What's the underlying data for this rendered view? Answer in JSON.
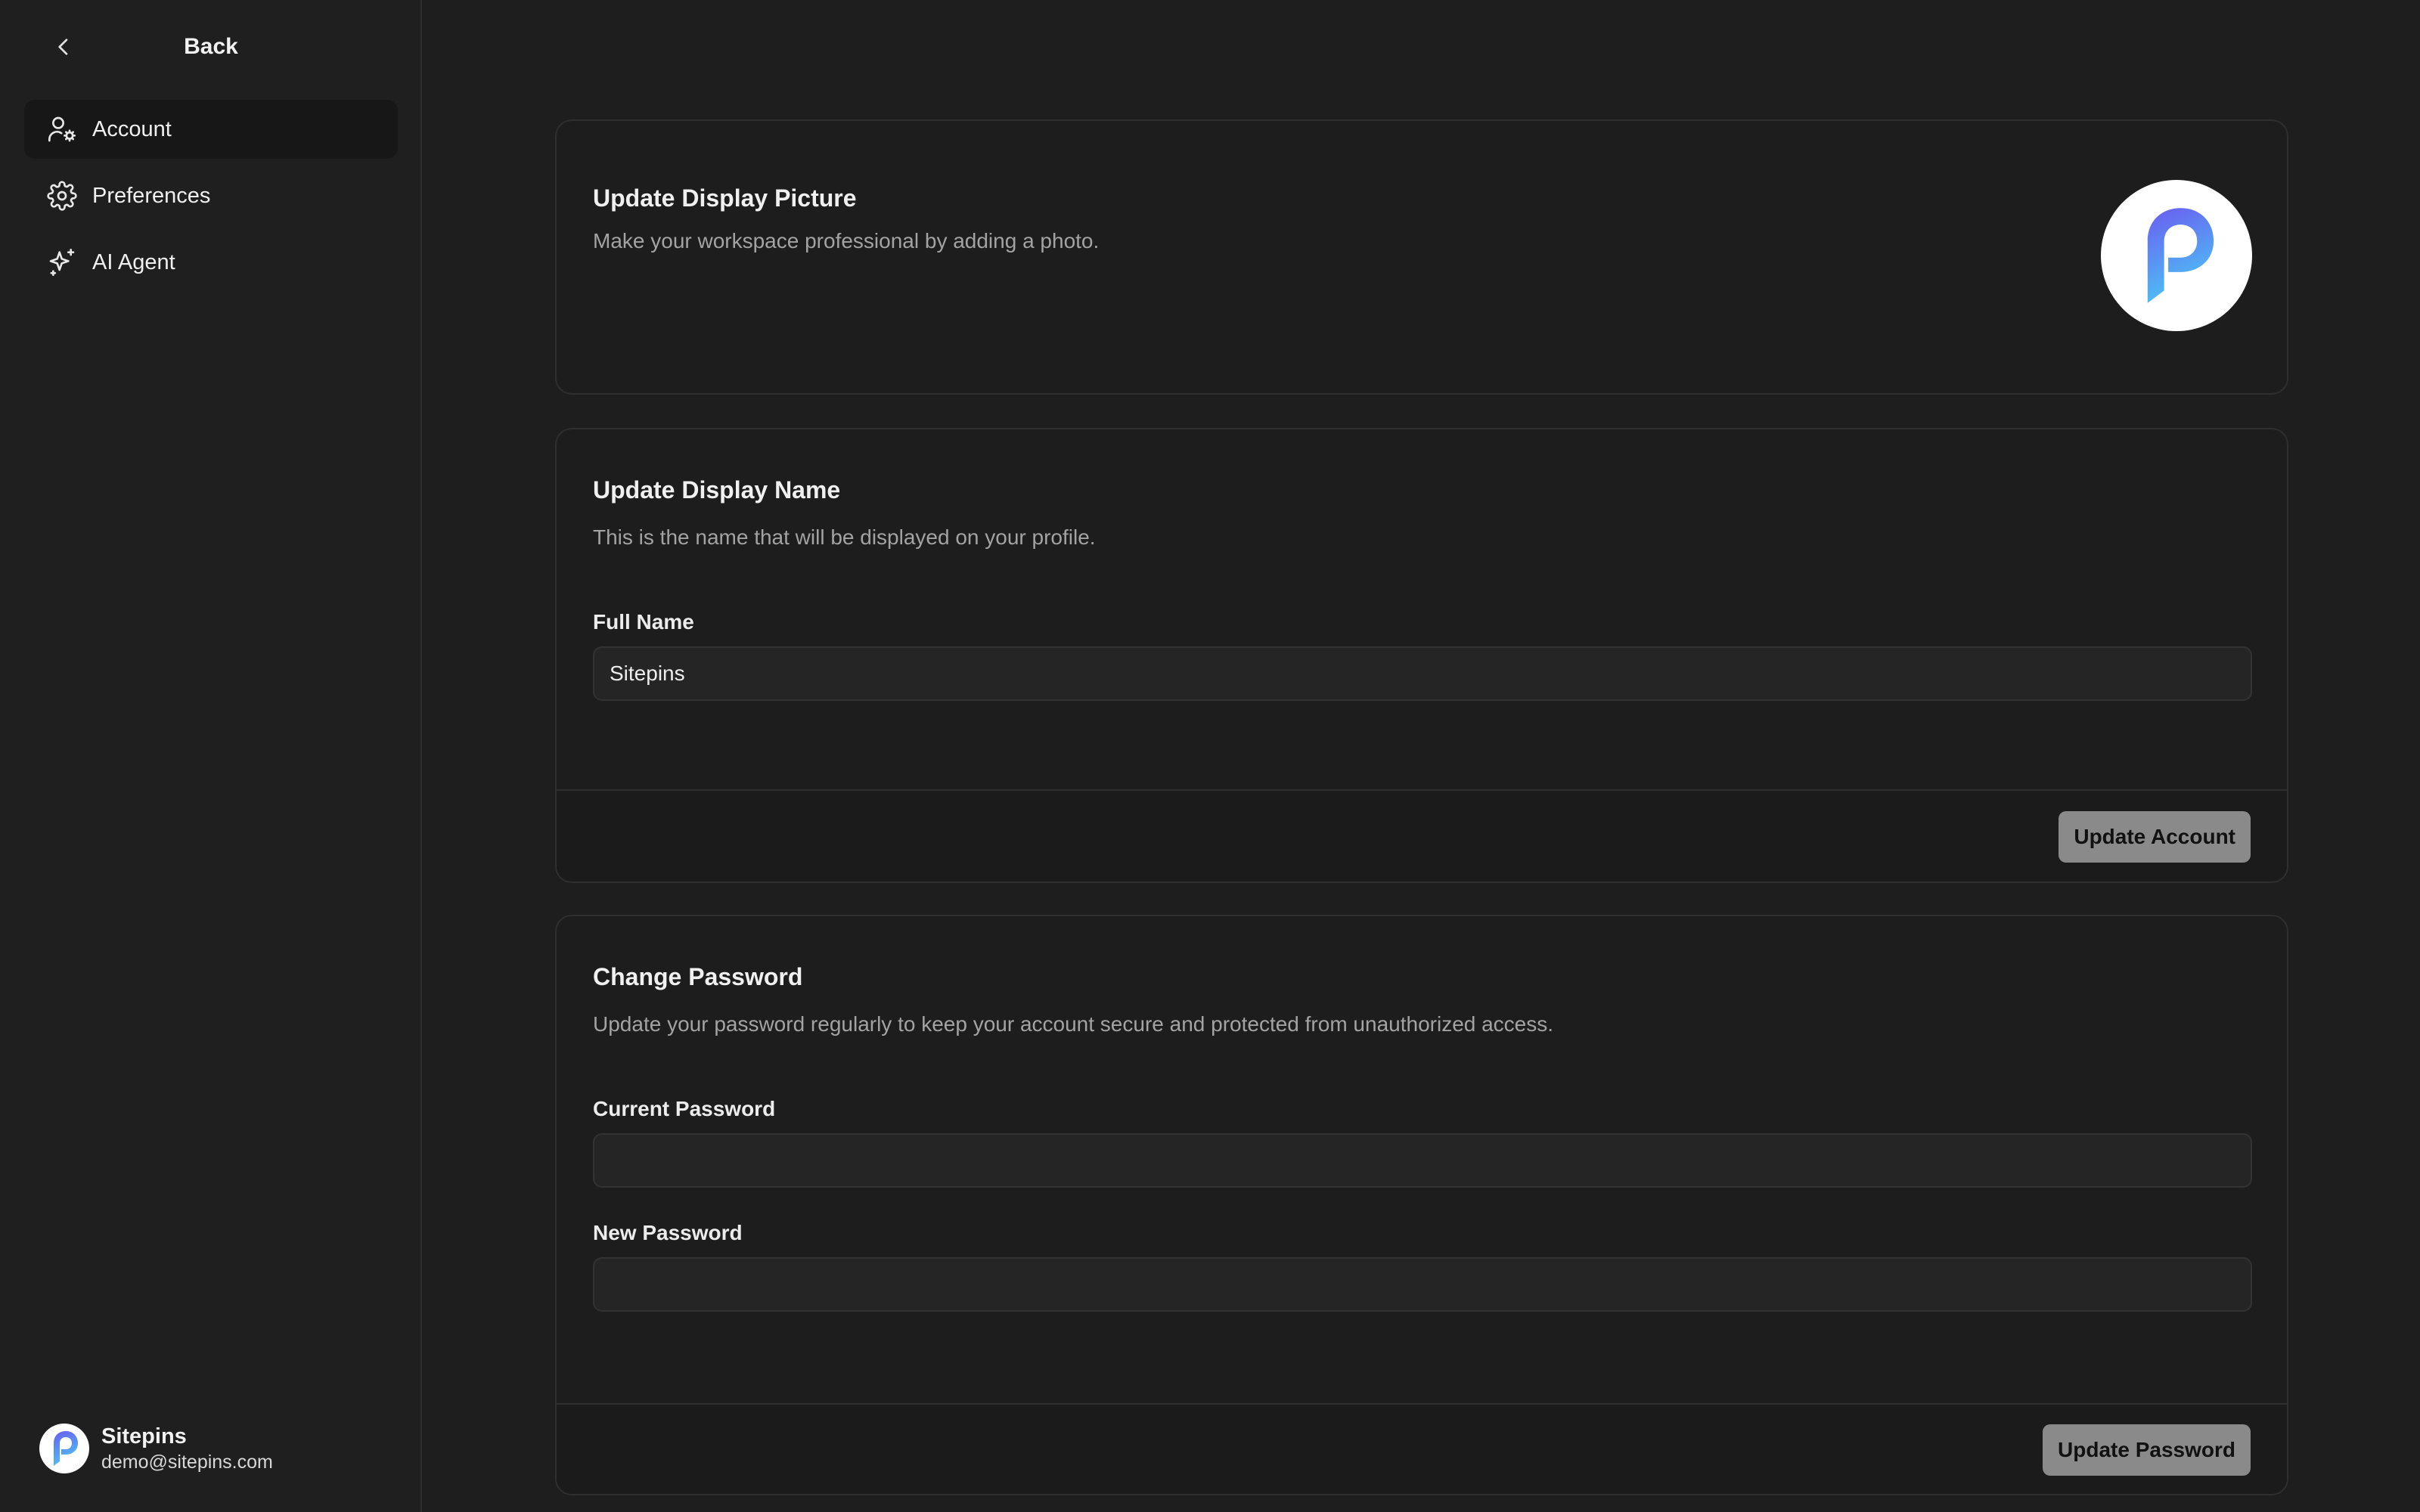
{
  "sidebar": {
    "back_label": "Back",
    "items": [
      {
        "label": "Account",
        "icon": "user-gear-icon",
        "active": true
      },
      {
        "label": "Preferences",
        "icon": "gear-icon",
        "active": false
      },
      {
        "label": "AI Agent",
        "icon": "sparkles-icon",
        "active": false
      }
    ],
    "user": {
      "name": "Sitepins",
      "email": "demo@sitepins.com"
    }
  },
  "display_picture": {
    "title": "Update Display Picture",
    "description": "Make your workspace professional by adding a photo."
  },
  "display_name": {
    "title": "Update Display Name",
    "description": "This is the name that will be displayed on your profile.",
    "field_label": "Full Name",
    "field_value": "Sitepins",
    "button_label": "Update Account"
  },
  "password": {
    "title": "Change Password",
    "description": "Update your password regularly to keep your account secure and protected from unauthorized access.",
    "current_label": "Current Password",
    "current_value": "",
    "new_label": "New Password",
    "new_value": "",
    "button_label": "Update Password"
  },
  "colors": {
    "background": "#1e1e1e",
    "sidebar_active": "#171717",
    "button": "#8a8a8a",
    "logo_gradient_start": "#6b5cf0",
    "logo_gradient_end": "#4cc2f5"
  }
}
